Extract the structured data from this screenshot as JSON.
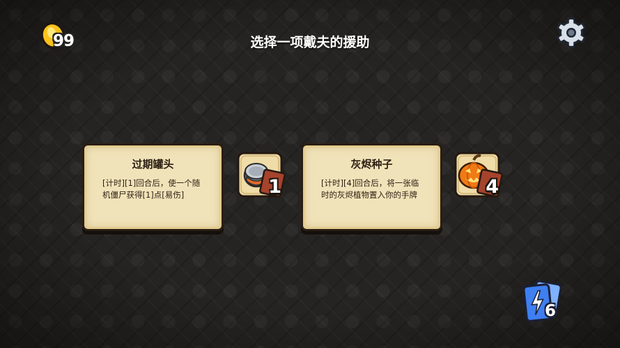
{
  "currency": {
    "icon": "gold-coin-icon",
    "count": "99"
  },
  "header": {
    "title": "选择一项戴夫的援助",
    "settings_icon": "gear-icon"
  },
  "options": [
    {
      "title": "过期罐头",
      "description": "[计时][1]回合后，使一个随机僵尸获得[1]点[易伤]",
      "item_icon": "tin-can-icon",
      "count": "1"
    },
    {
      "title": "灰烬种子",
      "description": "[计时][4]回合后，将一张临时的灰烬植物置入你的手牌",
      "item_icon": "jack-o-lantern-icon",
      "count": "4"
    }
  ],
  "deck": {
    "icon": "lightning-card-deck-icon",
    "count": "6"
  },
  "colors": {
    "card_bg": "#f1e3b9",
    "card_border": "#2a1d12",
    "background": "#262422",
    "deck_blue": "#3f7ff0"
  }
}
